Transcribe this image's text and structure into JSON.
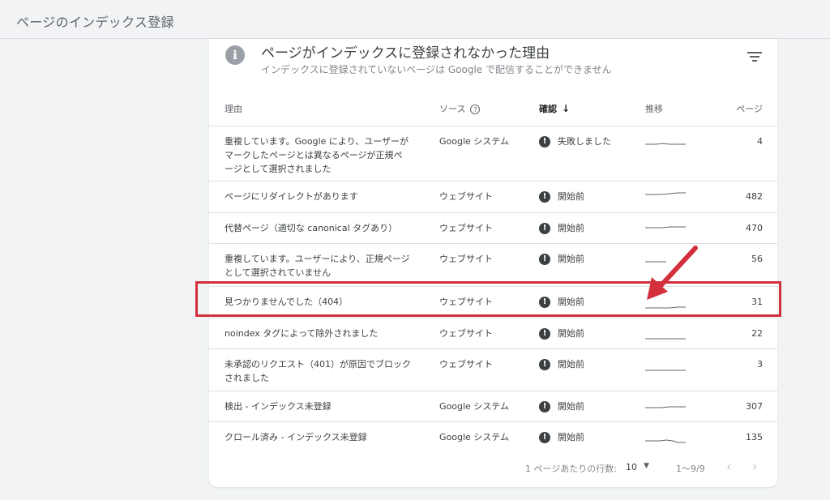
{
  "page": {
    "title": "ページのインデックス登録"
  },
  "card": {
    "title": "ページがインデックスに登録されなかった理由",
    "subtitle": "インデックスに登録されていないページは Google で配信することができません"
  },
  "columns": {
    "reason": "理由",
    "source": "ソース",
    "confirm": "確認",
    "trend": "推移",
    "pages": "ページ"
  },
  "rows": [
    {
      "reason": "重複しています。Google により、ユーザーがマークしたページとは異なるページが正規ページとして選択されました",
      "source": "Google システム",
      "status": "失敗しました",
      "pages": "4"
    },
    {
      "reason": "ページにリダイレクトがあります",
      "source": "ウェブサイト",
      "status": "開始前",
      "pages": "482"
    },
    {
      "reason": "代替ページ（適切な canonical タグあり）",
      "source": "ウェブサイト",
      "status": "開始前",
      "pages": "470"
    },
    {
      "reason": "重複しています。ユーザーにより、正規ページとして選択されていません",
      "source": "ウェブサイト",
      "status": "開始前",
      "pages": "56"
    },
    {
      "reason": "見つかりませんでした（404）",
      "source": "ウェブサイト",
      "status": "開始前",
      "pages": "31"
    },
    {
      "reason": "noindex タグによって除外されました",
      "source": "ウェブサイト",
      "status": "開始前",
      "pages": "22"
    },
    {
      "reason": "未承認のリクエスト（401）が原因でブロックされました",
      "source": "ウェブサイト",
      "status": "開始前",
      "pages": "3"
    },
    {
      "reason": "検出 - インデックス未登録",
      "source": "Google システム",
      "status": "開始前",
      "pages": "307"
    },
    {
      "reason": "クロール済み - インデックス未登録",
      "source": "Google システム",
      "status": "開始前",
      "pages": "135"
    }
  ],
  "footer": {
    "rows_per_page_label": "1 ページあたりの行数:",
    "rows_per_page_value": "10",
    "range": "1～9/9"
  },
  "annotation": {
    "highlight_color": "#d32f3c"
  }
}
